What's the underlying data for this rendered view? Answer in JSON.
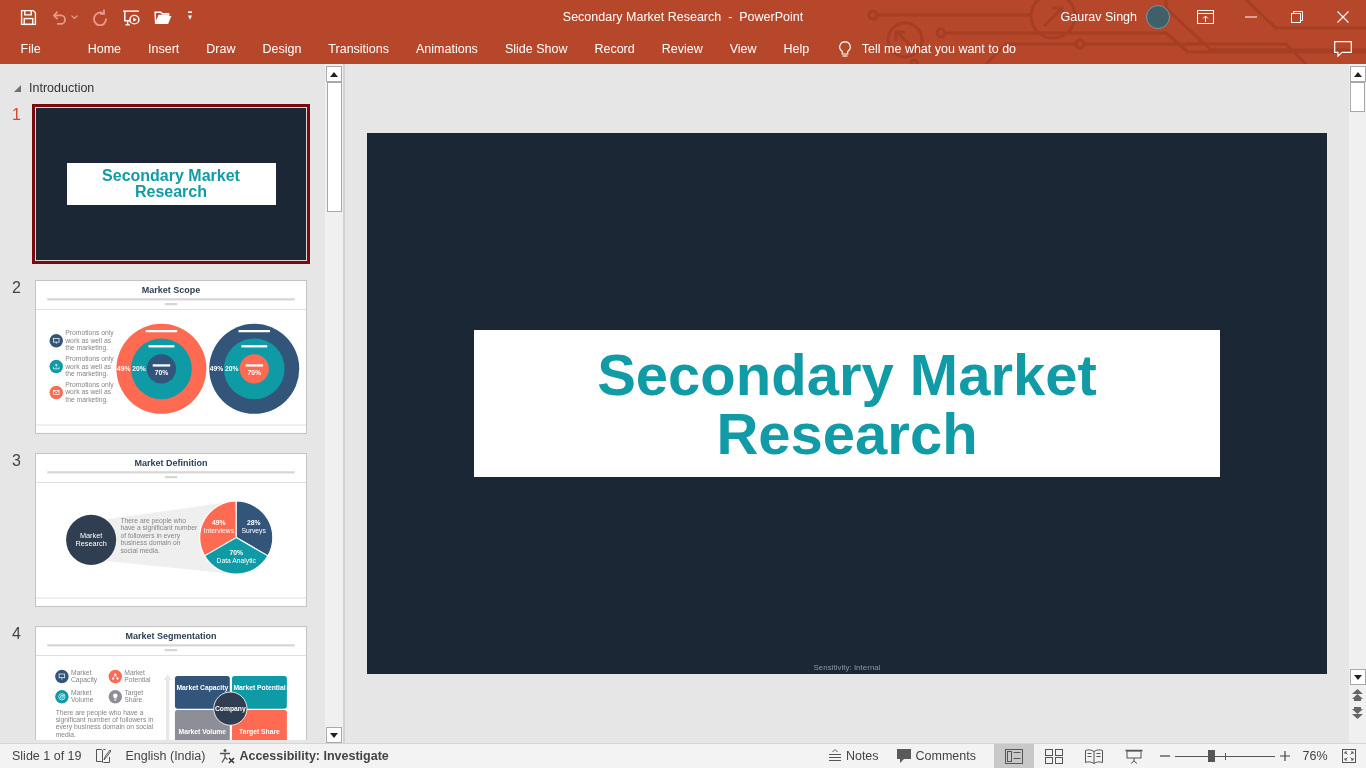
{
  "window": {
    "title": "Secondary Market Research  -  PowerPoint",
    "user": "Gaurav Singh"
  },
  "quick_access": [
    {
      "kind": "save",
      "disabled": false
    },
    {
      "kind": "undo",
      "disabled": true
    },
    {
      "kind": "redo",
      "disabled": true
    },
    {
      "kind": "present",
      "disabled": false
    },
    {
      "kind": "open",
      "disabled": false
    },
    {
      "kind": "customize",
      "disabled": false
    }
  ],
  "ribbon": {
    "tabs": [
      "File",
      "Home",
      "Insert",
      "Draw",
      "Design",
      "Transitions",
      "Animations",
      "Slide Show",
      "Record",
      "Review",
      "View",
      "Help"
    ],
    "tell_me": {
      "placeholder": "Tell me what you want to do"
    }
  },
  "thumbnail_pane": {
    "section": {
      "label": "Introduction",
      "expanded": true
    },
    "slides": [
      {
        "number": "1",
        "selected": true,
        "kind": "title",
        "title": "Secondary Market Research"
      },
      {
        "number": "2",
        "selected": false,
        "kind": "scope",
        "title": "Market Scope",
        "points": [
          {
            "text": "Promotions only work as well as the marketing.",
            "color": "#34557a"
          },
          {
            "text": "Promotions only work as well as the marketing.",
            "color": "#0e9ba5"
          },
          {
            "text": "Promotions only work as well as the marketing.",
            "color": "#fe6a52"
          }
        ],
        "rings": [
          {
            "layers": [
              {
                "value": "49%",
                "color": "#fe6a52"
              },
              {
                "value": "20%",
                "color": "#0e9ba5"
              },
              {
                "value": "70%",
                "color": "#34557a"
              }
            ]
          },
          {
            "layers": [
              {
                "value": "49%",
                "color": "#34557a"
              },
              {
                "value": "20%",
                "color": "#0e9ba5"
              },
              {
                "value": "70%",
                "color": "#fe6a52"
              }
            ]
          }
        ]
      },
      {
        "number": "3",
        "selected": false,
        "kind": "definition",
        "title": "Market Definition",
        "hub": "Market Research",
        "text": "There are people who have a significant number of followers in every business domain on social media.",
        "pie": [
          {
            "label": "Interviews",
            "value": "49%",
            "color": "#fe6a52"
          },
          {
            "label": "Surveys",
            "value": "28%",
            "color": "#34557a"
          },
          {
            "label": "Data Analytic",
            "value": "70%",
            "color": "#0e9ba5"
          }
        ]
      },
      {
        "number": "4",
        "selected": false,
        "kind": "segmentation",
        "title": "Market Segmentation",
        "legend": [
          {
            "label": "Market Capacity",
            "color": "#34557a"
          },
          {
            "label": "Market Potential",
            "color": "#fe6a52"
          },
          {
            "label": "Market Volume",
            "color": "#0e9ba5"
          },
          {
            "label": "Target Share",
            "color": "#8e8e99"
          }
        ],
        "text": "There are people who have a significant number of followers in every business domain on social media.",
        "quadrants": [
          {
            "label": "Market Capacity",
            "color": "#34557a"
          },
          {
            "label": "Market Potential",
            "color": "#0e9ba5"
          },
          {
            "label": "Market Volume",
            "color": "#8e8e99"
          },
          {
            "label": "Target Share",
            "color": "#fe6a52"
          }
        ],
        "center": "Company"
      }
    ]
  },
  "editor": {
    "slide": {
      "title": "Secondary Market Research",
      "footer": "Sensitivity: Internal"
    }
  },
  "status_bar": {
    "slide_info": "Slide 1 of 19",
    "language": "English (India)",
    "accessibility": "Accessibility: Investigate",
    "notes": "Notes",
    "comments": "Comments",
    "views": [
      {
        "kind": "normal",
        "selected": true
      },
      {
        "kind": "sorter",
        "selected": false
      },
      {
        "kind": "reading",
        "selected": false
      },
      {
        "kind": "slideshow",
        "selected": false
      }
    ],
    "zoom": {
      "level": 0.36,
      "reading": "76%"
    }
  }
}
